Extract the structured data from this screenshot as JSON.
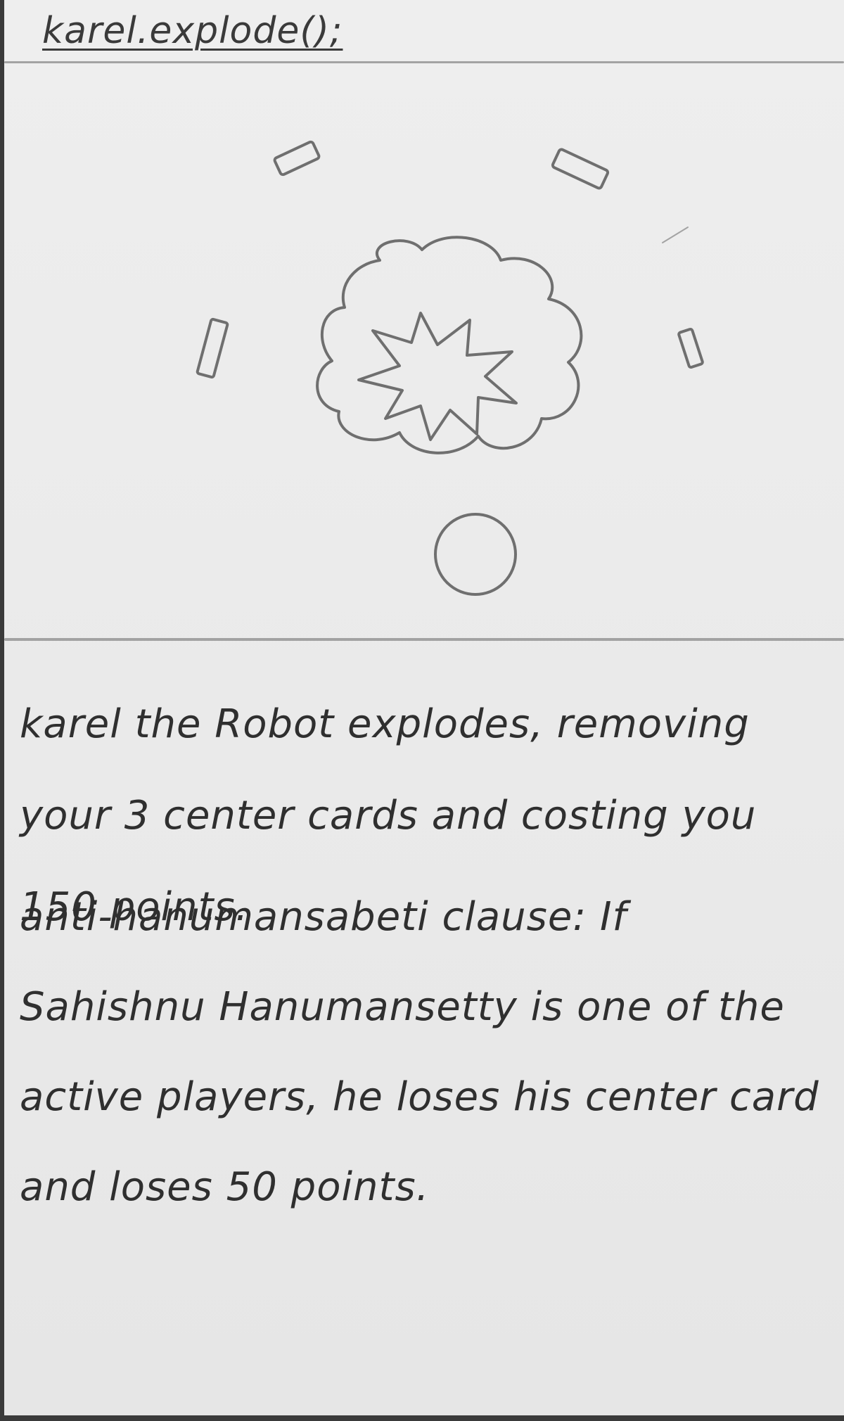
{
  "card": {
    "title": "karel.explode();",
    "illustration": {
      "subject": "explosion",
      "debris_count": 4,
      "remnant": "circle"
    },
    "description": "karel the Robot explodes, removing your 3 center cards and costing you 150 points.",
    "clause": "anti-hanumansabeti clause: If Sahishnu Hanumansetty is one of the active players, he loses his center card and loses 50 points."
  }
}
